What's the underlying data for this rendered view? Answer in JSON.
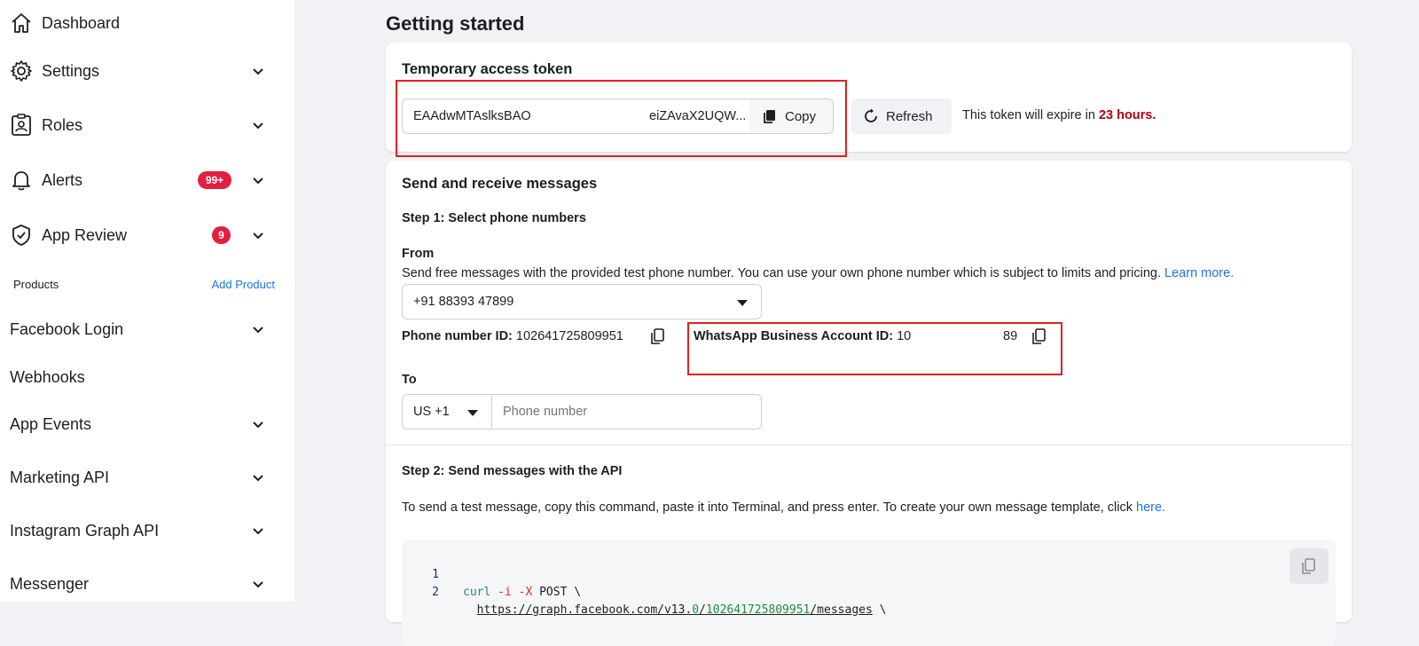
{
  "sidebar": {
    "items": [
      {
        "label": "Dashboard",
        "icon": "home-icon"
      },
      {
        "label": "Settings",
        "icon": "gear-icon"
      },
      {
        "label": "Roles",
        "icon": "id-card-icon"
      },
      {
        "label": "Alerts",
        "icon": "bell-icon",
        "badge": "99+"
      },
      {
        "label": "App Review",
        "icon": "shield-check-icon",
        "badge": "9"
      }
    ],
    "products_label": "Products",
    "add_product": "Add Product",
    "products": [
      {
        "label": "Facebook Login"
      },
      {
        "label": "Webhooks"
      },
      {
        "label": "App Events"
      },
      {
        "label": "Marketing API"
      },
      {
        "label": "Instagram Graph API"
      },
      {
        "label": "Messenger"
      }
    ]
  },
  "main": {
    "title": "Getting started",
    "token_card": {
      "title": "Temporary access token",
      "token_start": "EAAdwMTAslksBAO",
      "token_end": "еiZAvaX2UQW...",
      "copy_label": "Copy",
      "refresh_label": "Refresh",
      "expire_prefix": "This token will expire in",
      "expire_value": "23 hours."
    },
    "messages_card": {
      "title": "Send and receive messages",
      "step1": "Step 1: Select phone numbers",
      "from_label": "From",
      "from_desc": "Send free messages with the provided test phone number. You can use your own phone number which is subject to limits and pricing.",
      "learn_more": "Learn more.",
      "from_number": "+91 88393 47899",
      "phone_id_label": "Phone number ID:",
      "phone_id_value": "102641725809951",
      "waba_label": "WhatsApp Business Account ID:",
      "waba_value_start": "10",
      "waba_value_end": "89",
      "to_label": "To",
      "country_code": "US +1",
      "phone_placeholder": "Phone number",
      "step2": "Step 2: Send messages with the API",
      "step2_desc": "To send a test message, copy this command, paste it into Terminal, and press enter. To create your own message template, click",
      "here_link": "here.",
      "code_lines": [
        {
          "num": "1"
        },
        {
          "num": "2",
          "url_prefix": "https://graph.facebook.com/v13.",
          "url_ver": "0",
          "url_mid": "/",
          "url_id": "102641725809951",
          "url_suffix": "/messages",
          "tail": " \\"
        }
      ]
    }
  },
  "colors": {
    "accent": "#1b74e4",
    "badge": "#e41e3f",
    "highlight": "#e02020",
    "expire": "#b3000c"
  }
}
